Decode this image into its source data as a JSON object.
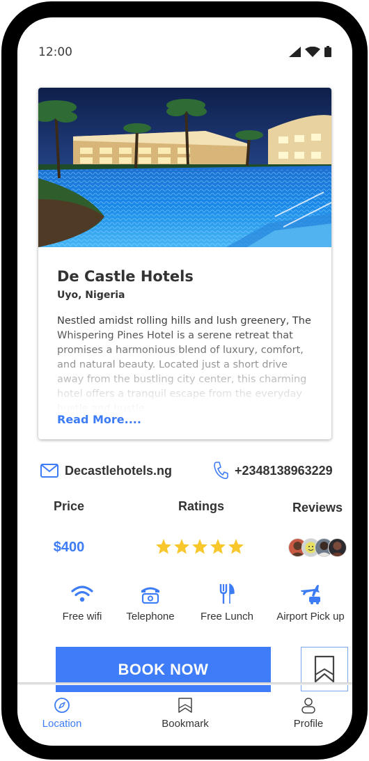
{
  "status_bar": {
    "time": "12:00",
    "icons": [
      "signal-icon",
      "wifi-icon",
      "battery-icon"
    ]
  },
  "hotel": {
    "name": "De Castle Hotels",
    "location": "Uyo, Nigeria",
    "description": "Nestled amidst rolling hills and lush greenery, The Whispering Pines Hotel is a serene retreat that promises a harmonious blend of luxury, comfort, and natural beauty. Located just a short drive away from the bustling city center, this charming hotel offers a tranquil escape from the everyday hustle and bustle.",
    "read_more": "Read More....",
    "image": "hotel-pool-photo"
  },
  "contact": {
    "email": "Decastlehotels.ng",
    "phone": "+2348138963229"
  },
  "stats": {
    "price_label": "Price",
    "price_value": "$400",
    "ratings_label": "Ratings",
    "rating_stars": 5,
    "reviews_label": "Reviews",
    "review_avatar_count": 4
  },
  "amenities": [
    {
      "label": "Free wifi",
      "icon": "wifi-icon"
    },
    {
      "label": "Telephone",
      "icon": "telephone-icon"
    },
    {
      "label": "Free Lunch",
      "icon": "fork-knife-icon"
    },
    {
      "label": "Airport Pick up",
      "icon": "airport-pickup-icon"
    }
  ],
  "actions": {
    "book_label": "BOOK NOW",
    "bookmark_icon": "bookmark-icon"
  },
  "bottom_nav": [
    {
      "label": "Location",
      "icon": "compass-icon",
      "active": true
    },
    {
      "label": "Bookmark",
      "icon": "bookmark-icon",
      "active": false
    },
    {
      "label": "Profile",
      "icon": "profile-icon",
      "active": false
    }
  ],
  "colors": {
    "accent": "#3f7cf7",
    "text": "#333333",
    "star": "#f8c72c",
    "frame": "#000000"
  }
}
